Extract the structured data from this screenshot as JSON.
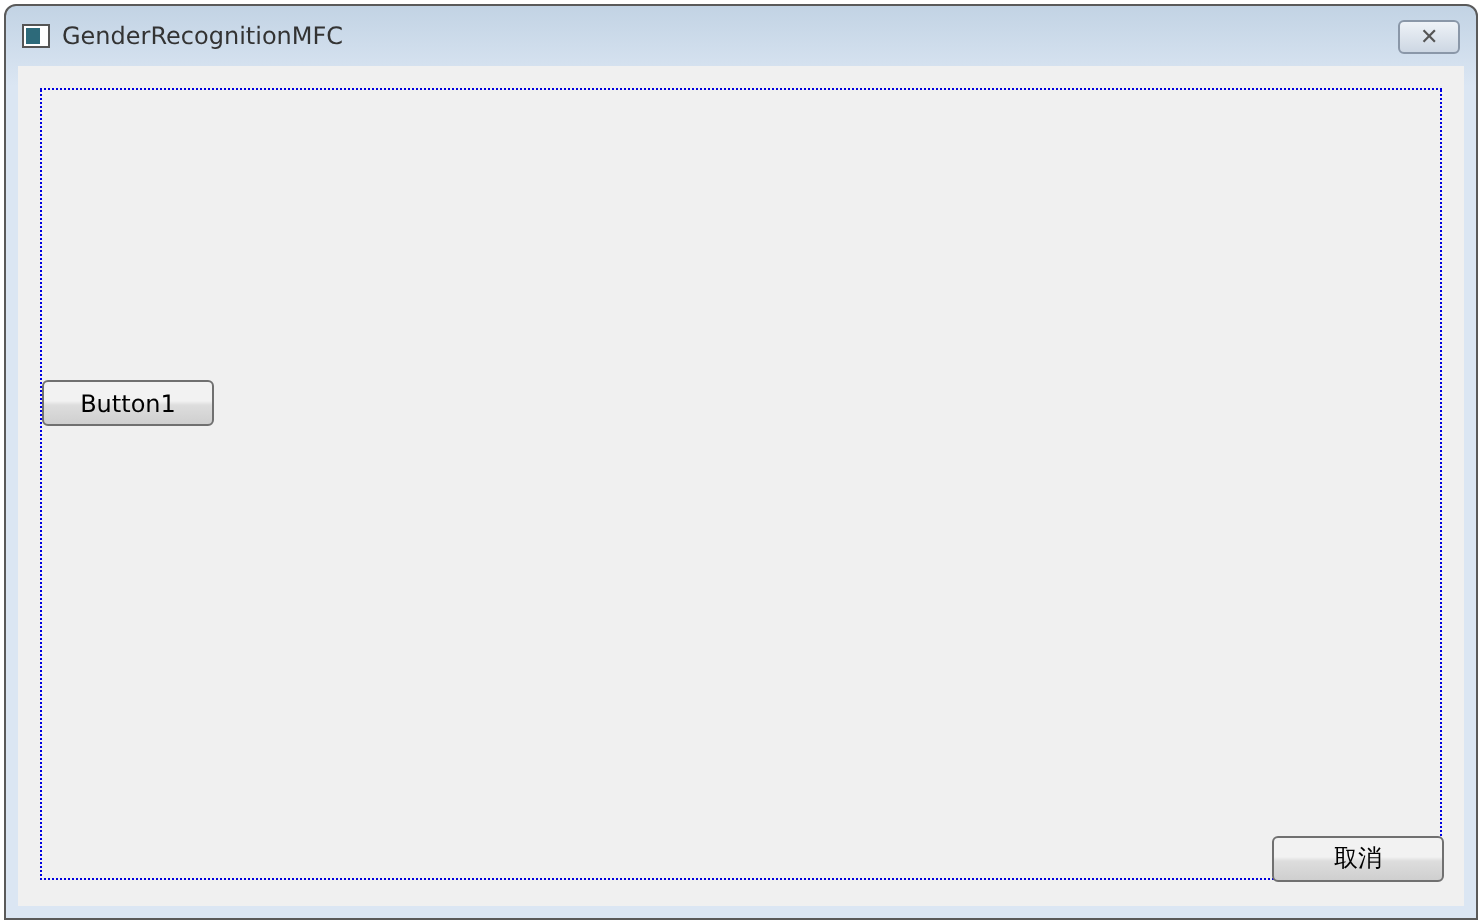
{
  "window": {
    "title": "GenderRecognitionMFC",
    "close_label": "✕"
  },
  "buttons": [
    {
      "kind": "left",
      "label": "Button1"
    },
    {
      "kind": "bottom-right",
      "label": "取消"
    }
  ]
}
